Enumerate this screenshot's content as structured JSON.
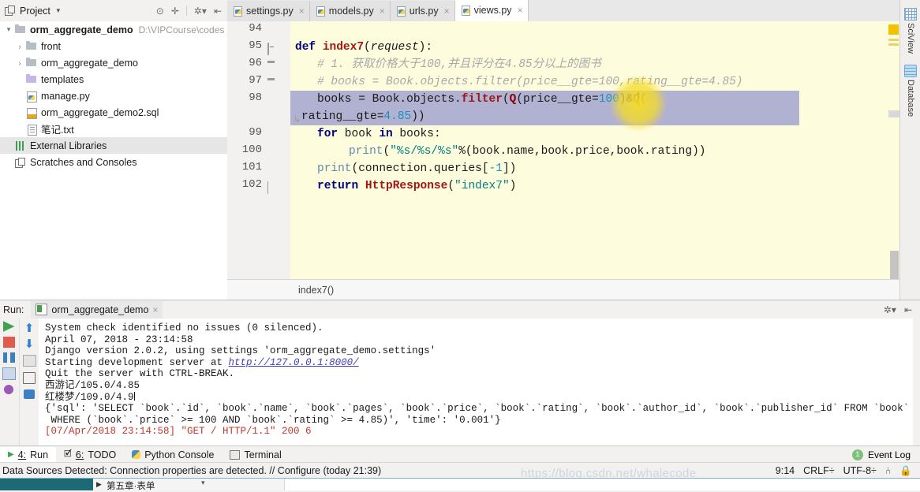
{
  "window": {
    "project_panel_title": "Project",
    "ghost_toolbar": ""
  },
  "project_toolbar": {
    "icons": [
      "locate-icon",
      "expand-all-icon",
      "settings-icon",
      "collapse-icon"
    ]
  },
  "tree": {
    "items": [
      {
        "arrow": "▾",
        "icon": "folder-icon",
        "label": "orm_aggregate_demo",
        "bold": true,
        "path": "D:\\VIPCourse\\codes",
        "indent": 0,
        "selected": false
      },
      {
        "arrow": "›",
        "icon": "folder-icon",
        "label": "front",
        "bold": false,
        "path": "",
        "indent": 1,
        "selected": false
      },
      {
        "arrow": "›",
        "icon": "folder-icon",
        "label": "orm_aggregate_demo",
        "bold": false,
        "path": "",
        "indent": 1,
        "selected": false
      },
      {
        "arrow": "",
        "icon": "folder-purple-icon",
        "label": "templates",
        "bold": false,
        "path": "",
        "indent": 1,
        "selected": false
      },
      {
        "arrow": "",
        "icon": "python-file-icon",
        "label": "manage.py",
        "bold": false,
        "path": "",
        "indent": 1,
        "selected": false
      },
      {
        "arrow": "",
        "icon": "sql-file-icon",
        "label": "orm_aggregate_demo2.sql",
        "bold": false,
        "path": "",
        "indent": 1,
        "selected": false
      },
      {
        "arrow": "",
        "icon": "text-file-icon",
        "label": "笔记.txt",
        "bold": false,
        "path": "",
        "indent": 1,
        "selected": false
      },
      {
        "arrow": "",
        "icon": "library-icon",
        "label": "External Libraries",
        "bold": false,
        "path": "",
        "indent": 0,
        "selected": true
      },
      {
        "arrow": "",
        "icon": "scratches-icon",
        "label": "Scratches and Consoles",
        "bold": false,
        "path": "",
        "indent": 0,
        "selected": false
      }
    ]
  },
  "editor": {
    "tabs": [
      {
        "label": "settings.py",
        "active": false
      },
      {
        "label": "models.py",
        "active": false
      },
      {
        "label": "urls.py",
        "active": false
      },
      {
        "label": "views.py",
        "active": true
      }
    ],
    "close_glyph": "×",
    "line_numbers": [
      "94",
      "95",
      "96",
      "97",
      "98",
      "99",
      "100",
      "101",
      "102"
    ],
    "lines": {
      "l95_def": "def",
      "l95_name": "index7",
      "l95_open": "(",
      "l95_param": "request",
      "l95_close": "):",
      "l96_comment": "# 1. 获取价格大于100,并且评分在4.85分以上的图书",
      "l97_comment": "# books = Book.objects.filter(price__gte=100,rating__gte=4.85)",
      "l98_a": "books = Book.objects.",
      "l98_filter": "filter",
      "l98_b": "(",
      "l98_q1": "Q",
      "l98_c": "(price__gte=",
      "l98_n1": "100",
      "l98_d": ")",
      "l98_amp": "&",
      "l98_q2": "Q",
      "l98_e": "(",
      "l98_wrap_a": "rating__gte=",
      "l98_wrap_n": "4.85",
      "l98_wrap_b": "))",
      "l99_for": "for",
      "l99_book": " book ",
      "l99_in": "in",
      "l99_rest": " books:",
      "l100_print": "print",
      "l100_open": "(",
      "l100_str": "\"%s/%s/%s\"",
      "l100_rest": "%(book.name,book.price,book.rating))",
      "l101_print": "print",
      "l101_a": "(connection.queries[",
      "l101_n": "-1",
      "l101_b": "])",
      "l102_return": "return",
      "l102_cls": "HttpResponse",
      "l102_a": "(",
      "l102_str": "\"index7\"",
      "l102_b": ")"
    },
    "breadcrumb": "index7()"
  },
  "right_strip": {
    "buttons": [
      {
        "label": "SciView",
        "icon": "sciview-icon"
      },
      {
        "label": "Database",
        "icon": "database-icon"
      }
    ]
  },
  "run_panel": {
    "label": "Run:",
    "tab_label": "orm_aggregate_demo",
    "tab_close": "×",
    "header_icons": [
      "settings-icon",
      "hide-icon"
    ],
    "toolbar_left": [
      "rerun-icon",
      "stop-icon",
      "pause-icon",
      "thread-dump-icon",
      "pin-icon"
    ],
    "toolbar_right": [
      "scroll-up-icon",
      "scroll-down-icon",
      "soft-wrap-icon",
      "export-icon",
      "print-icon"
    ],
    "output": [
      {
        "text": "System check identified no issues (0 silenced).",
        "type": "plain"
      },
      {
        "text": "April 07, 2018 - 23:14:58",
        "type": "plain"
      },
      {
        "text": "Django version 2.0.2, using settings 'orm_aggregate_demo.settings'",
        "type": "plain"
      },
      {
        "pre": "Starting development server at ",
        "link": "http://127.0.0.1:8000/",
        "type": "link"
      },
      {
        "text": "Quit the server with CTRL-BREAK.",
        "type": "plain"
      },
      {
        "text": "西游记/105.0/4.85",
        "type": "plain"
      },
      {
        "text": "红楼梦/109.0/4.9",
        "type": "caret"
      },
      {
        "text": "{'sql': 'SELECT `book`.`id`, `book`.`name`, `book`.`pages`, `book`.`price`, `book`.`rating`, `book`.`author_id`, `book`.`publisher_id` FROM `book`",
        "type": "plain"
      },
      {
        "text": " WHERE (`book`.`price` >= 100 AND `book`.`rating` >= 4.85)', 'time': '0.001'}",
        "type": "plain"
      },
      {
        "text": "[07/Apr/2018 23:14:58] \"GET / HTTP/1.1\" 200 6",
        "type": "red"
      }
    ]
  },
  "bottom_bar": {
    "items": [
      {
        "num": "4:",
        "label": "Run",
        "icon": "run-icon",
        "active": true
      },
      {
        "num": "6:",
        "label": "TODO",
        "icon": "todo-icon",
        "active": false
      },
      {
        "num": "",
        "label": "Python Console",
        "icon": "python-icon",
        "active": false
      },
      {
        "num": "",
        "label": "Terminal",
        "icon": "terminal-icon",
        "active": false
      }
    ],
    "event_log": "Event Log",
    "event_count": "1"
  },
  "status_bar": {
    "message": "Data Sources Detected: Connection properties are detected. // Configure (today 21:39)",
    "caret_position": "9:14",
    "line_separator": "CRLF÷",
    "encoding": "UTF-8÷",
    "icons": [
      "branch-icon",
      "lock-icon"
    ]
  },
  "watermark": "https://blog.csdn.net/whalecode",
  "background_window": {
    "tri": "▶",
    "text": "第五章·表单",
    "caret": "▾"
  },
  "colors": {
    "editor_bg": "#fdfdde",
    "selection": "#a3a3cf",
    "keyword": "#000080",
    "string": "#008080",
    "number": "#1a8fbf",
    "comment": "#a8a8a8",
    "class": "#a31515",
    "link": "#4040c0",
    "error": "#c0392b"
  }
}
